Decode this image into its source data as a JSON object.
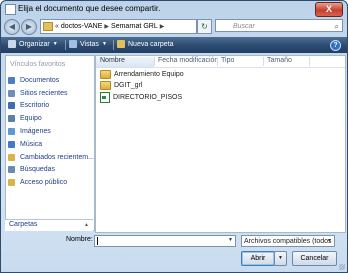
{
  "window": {
    "title": "Elija el documento que desee compartir.",
    "close_label": "X"
  },
  "address_bar": {
    "back_glyph": "◀",
    "forward_glyph": "▶",
    "overflow_glyph": "«",
    "breadcrumbs": [
      "doctos-VANE",
      "Semarnat GRL"
    ],
    "refresh_glyph": "↻",
    "search_placeholder": "Buscar",
    "search_glyph": "⌕"
  },
  "toolbar": {
    "organize_label": "Organizar",
    "views_label": "Vistas",
    "new_folder_label": "Nueva carpeta",
    "help_glyph": "?"
  },
  "nav_pane": {
    "favorites_title": "Vínculos favoritos",
    "items": [
      {
        "label": "Documentos",
        "icon": "documents-icon",
        "color": "#4b7fc0"
      },
      {
        "label": "Sitios recientes",
        "icon": "recent-places-icon",
        "color": "#6d8fb8"
      },
      {
        "label": "Escritorio",
        "icon": "desktop-icon",
        "color": "#3d6fb0"
      },
      {
        "label": "Equipo",
        "icon": "computer-icon",
        "color": "#5a7fa8"
      },
      {
        "label": "Imágenes",
        "icon": "pictures-icon",
        "color": "#5d9acf"
      },
      {
        "label": "Música",
        "icon": "music-icon",
        "color": "#3f7bc6"
      },
      {
        "label": "Cambiados recientem...",
        "icon": "recently-changed-icon",
        "color": "#d9b24a"
      },
      {
        "label": "Búsquedas",
        "icon": "searches-icon",
        "color": "#6a8ab0"
      },
      {
        "label": "Acceso público",
        "icon": "public-folder-icon",
        "color": "#d9b24a"
      }
    ],
    "folders_label": "Carpetas",
    "folders_chevron": "▲"
  },
  "file_list": {
    "columns": [
      "Nombre",
      "Fecha modificación",
      "Tipo",
      "Tamaño"
    ],
    "sorted_column": "Nombre",
    "items": [
      {
        "name": "Arrendamiento Equipo",
        "kind": "folder"
      },
      {
        "name": "DGIT_grl",
        "kind": "folder"
      },
      {
        "name": "DIRECTORIO_PISOS",
        "kind": "excel"
      }
    ]
  },
  "footer": {
    "name_label": "Nombre:",
    "name_value": "",
    "file_type": "Archivos compatibles (todos l",
    "open_label": "Abrir",
    "cancel_label": "Cancelar",
    "dropdown_glyph": "▼"
  }
}
